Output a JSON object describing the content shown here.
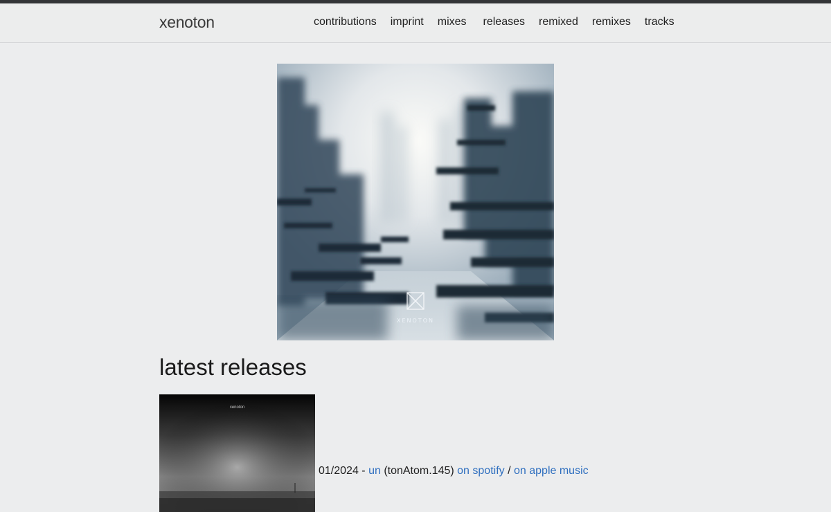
{
  "header": {
    "brand": "xenoton",
    "nav": [
      "contributions",
      "imprint",
      "mixes",
      "releases",
      "remixed",
      "remixes",
      "tracks"
    ]
  },
  "hero": {
    "logo_text": "XENOTON"
  },
  "latest": {
    "title": "latest releases",
    "releases": [
      {
        "cover_title": "xenoton",
        "date": "01/2024",
        "separator": " - ",
        "name": "un",
        "catalog": "(tonAtom.145)",
        "spotify": "on spotify",
        "slash": "/",
        "apple": "on apple music"
      }
    ]
  },
  "colors": {
    "background": "#ecedee",
    "link": "#2f6fbf",
    "topbar": "#333537"
  }
}
